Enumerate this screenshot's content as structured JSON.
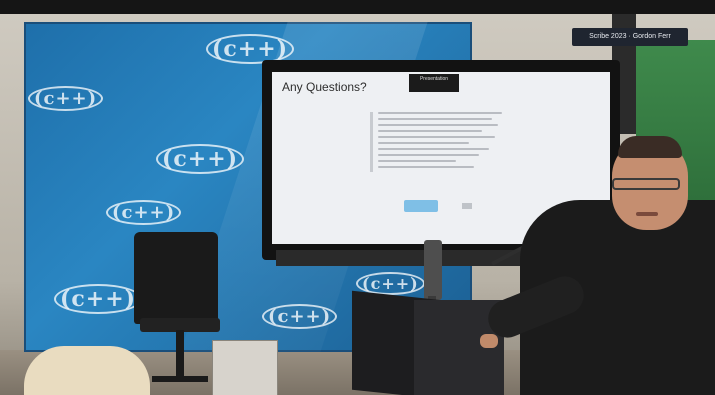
{
  "overlay": {
    "name_label": "Scribe 2023 · Gordon Ferr"
  },
  "screen": {
    "title": "Any Questions?",
    "presenter_tag": "Presentation",
    "top_right": ""
  },
  "backdrop": {
    "logo_text": "(c++)",
    "brand_color": "#2a86c2"
  }
}
